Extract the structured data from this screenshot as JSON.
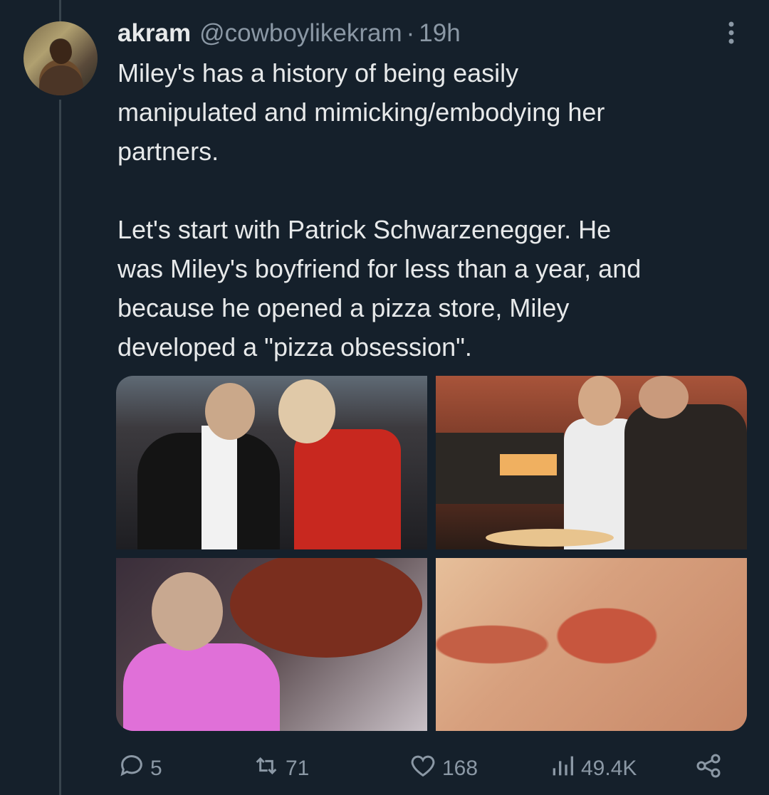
{
  "tweet": {
    "author_name": "akram",
    "author_handle": "@cowboylikekram",
    "separator": "·",
    "time_ago": "19h",
    "text": "Miley's has a history of being easily\nmanipulated and mimicking/embodying her\npartners.\n\nLet's start with Patrick Schwarzenegger. He\nwas Miley's boyfriend for less than a year, and\nbecause he opened a pizza store, Miley\ndeveloped a \"pizza obsession\"."
  },
  "media": {
    "count": 4
  },
  "actions": {
    "replies": "5",
    "reposts": "71",
    "likes": "168",
    "views": "49.4K"
  },
  "icons": {
    "more": "more-vertical-icon",
    "reply": "reply-icon",
    "repost": "repost-icon",
    "like": "heart-icon",
    "views": "views-icon",
    "share": "share-icon"
  },
  "colors": {
    "background": "#15202b",
    "text": "#e7e9ea",
    "muted": "#8b98a5",
    "thread_line": "#38444d"
  }
}
